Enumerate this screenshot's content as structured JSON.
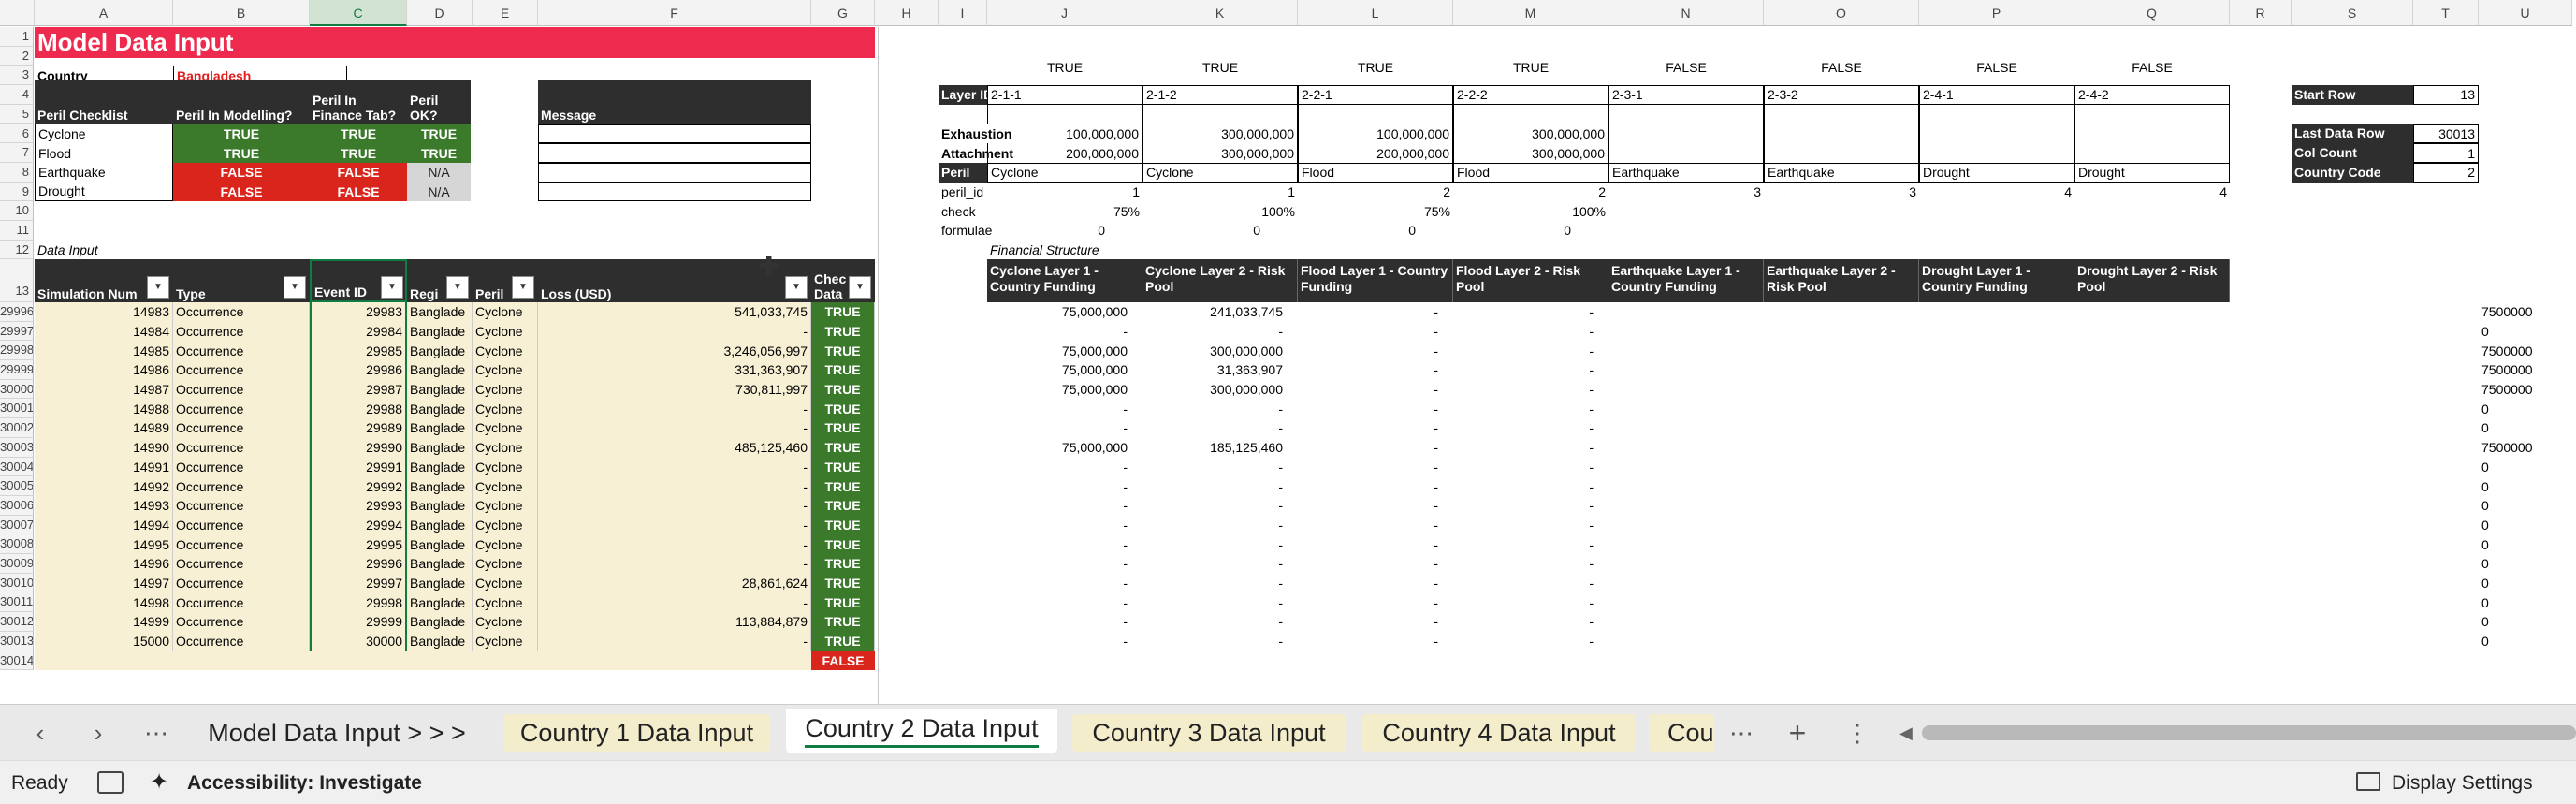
{
  "columns": [
    "A",
    "B",
    "C",
    "D",
    "E",
    "F",
    "G",
    "H",
    "I",
    "J",
    "K",
    "L",
    "M",
    "N",
    "O",
    "P",
    "Q",
    "R",
    "S",
    "T",
    "U"
  ],
  "row_numbers": [
    "1",
    "2",
    "3",
    "4",
    "5",
    "6",
    "7",
    "8",
    "9",
    "10",
    "11",
    "12",
    "13",
    "29996",
    "29997",
    "29998",
    "29999",
    "30000",
    "30001",
    "30002",
    "30003",
    "30004",
    "30005",
    "30006",
    "30007",
    "30008",
    "30009",
    "30010",
    "30011",
    "30012",
    "30013",
    "30014"
  ],
  "title": "Model Data Input",
  "country_label": "Country",
  "country_value": "Bangladesh",
  "peril_checklist": {
    "h1": "Peril Checklist",
    "h2": "Peril In Modelling?",
    "h3": "Peril In Finance Tab?",
    "h4": "Peril OK?",
    "h5": "Message",
    "rows": [
      {
        "name": "Cyclone",
        "m": "TRUE",
        "f": "TRUE",
        "ok": "TRUE"
      },
      {
        "name": "Flood",
        "m": "TRUE",
        "f": "TRUE",
        "ok": "TRUE"
      },
      {
        "name": "Earthquake",
        "m": "FALSE",
        "f": "FALSE",
        "ok": "N/A"
      },
      {
        "name": "Drought",
        "m": "FALSE",
        "f": "FALSE",
        "ok": "N/A"
      }
    ]
  },
  "data_input_label": "Data Input",
  "financial_structure_label": "Financial Structure",
  "table_headers": [
    "Simulation Num",
    "Type",
    "Event ID",
    "Regi",
    "Peril",
    "Loss (USD)",
    "Chec Data"
  ],
  "data_rows": [
    [
      "14983",
      "Occurrence",
      "29983",
      "Banglade",
      "Cyclone",
      "541,033,745",
      "TRUE"
    ],
    [
      "14984",
      "Occurrence",
      "29984",
      "Banglade",
      "Cyclone",
      "-",
      "TRUE"
    ],
    [
      "14985",
      "Occurrence",
      "29985",
      "Banglade",
      "Cyclone",
      "3,246,056,997",
      "TRUE"
    ],
    [
      "14986",
      "Occurrence",
      "29986",
      "Banglade",
      "Cyclone",
      "331,363,907",
      "TRUE"
    ],
    [
      "14987",
      "Occurrence",
      "29987",
      "Banglade",
      "Cyclone",
      "730,811,997",
      "TRUE"
    ],
    [
      "14988",
      "Occurrence",
      "29988",
      "Banglade",
      "Cyclone",
      "-",
      "TRUE"
    ],
    [
      "14989",
      "Occurrence",
      "29989",
      "Banglade",
      "Cyclone",
      "-",
      "TRUE"
    ],
    [
      "14990",
      "Occurrence",
      "29990",
      "Banglade",
      "Cyclone",
      "485,125,460",
      "TRUE"
    ],
    [
      "14991",
      "Occurrence",
      "29991",
      "Banglade",
      "Cyclone",
      "-",
      "TRUE"
    ],
    [
      "14992",
      "Occurrence",
      "29992",
      "Banglade",
      "Cyclone",
      "-",
      "TRUE"
    ],
    [
      "14993",
      "Occurrence",
      "29993",
      "Banglade",
      "Cyclone",
      "-",
      "TRUE"
    ],
    [
      "14994",
      "Occurrence",
      "29994",
      "Banglade",
      "Cyclone",
      "-",
      "TRUE"
    ],
    [
      "14995",
      "Occurrence",
      "29995",
      "Banglade",
      "Cyclone",
      "-",
      "TRUE"
    ],
    [
      "14996",
      "Occurrence",
      "29996",
      "Banglade",
      "Cyclone",
      "-",
      "TRUE"
    ],
    [
      "14997",
      "Occurrence",
      "29997",
      "Banglade",
      "Cyclone",
      "28,861,624",
      "TRUE"
    ],
    [
      "14998",
      "Occurrence",
      "29998",
      "Banglade",
      "Cyclone",
      "-",
      "TRUE"
    ],
    [
      "14999",
      "Occurrence",
      "29999",
      "Banglade",
      "Cyclone",
      "113,884,879",
      "TRUE"
    ],
    [
      "15000",
      "Occurrence",
      "30000",
      "Banglade",
      "Cyclone",
      "-",
      "TRUE"
    ]
  ],
  "last_check": "FALSE",
  "layers": {
    "flags": [
      "TRUE",
      "TRUE",
      "TRUE",
      "TRUE",
      "FALSE",
      "FALSE",
      "FALSE",
      "FALSE"
    ],
    "layer_id_label": "Layer ID",
    "ids": [
      "2-1-1",
      "2-1-2",
      "2-2-1",
      "2-2-2",
      "2-3-1",
      "2-3-2",
      "2-4-1",
      "2-4-2"
    ],
    "exhaustion_label": "Exhaustion",
    "exhaustion": [
      "100,000,000",
      "300,000,000",
      "100,000,000",
      "300,000,000",
      "",
      "",
      "",
      ""
    ],
    "attachment_label": "Attachment",
    "attachment": [
      "200,000,000",
      "300,000,000",
      "200,000,000",
      "300,000,000",
      "",
      "",
      "",
      ""
    ],
    "peril_label": "Peril",
    "perils": [
      "Cyclone",
      "Cyclone",
      "Flood",
      "Flood",
      "Earthquake",
      "Earthquake",
      "Drought",
      "Drought"
    ],
    "peril_id_label": "peril_id",
    "peril_ids": [
      "1",
      "1",
      "2",
      "2",
      "3",
      "3",
      "4",
      "4"
    ],
    "check_label": "check",
    "checks": [
      "75%",
      "100%",
      "75%",
      "100%",
      "",
      "",
      "",
      ""
    ],
    "formulae_label": "formulae",
    "formulae": [
      "0",
      "0",
      "0",
      "0",
      "",
      "",
      "",
      ""
    ],
    "headers": [
      "Cyclone Layer 1 - Country Funding",
      "Cyclone Layer 2 - Risk Pool",
      "Flood Layer 1 - Country Funding",
      "Flood Layer 2 - Risk Pool",
      "Earthquake Layer 1 - Country Funding",
      "Earthquake Layer 2 - Risk Pool",
      "Drought Layer 1 - Country Funding",
      "Drought Layer 2 - Risk Pool"
    ]
  },
  "fin_rows": [
    [
      "75,000,000",
      "241,033,745",
      "-",
      "-"
    ],
    [
      "-",
      "-",
      "-",
      "-"
    ],
    [
      "75,000,000",
      "300,000,000",
      "-",
      "-"
    ],
    [
      "75,000,000",
      "31,363,907",
      "-",
      "-"
    ],
    [
      "75,000,000",
      "300,000,000",
      "-",
      "-"
    ],
    [
      "-",
      "-",
      "-",
      "-"
    ],
    [
      "-",
      "-",
      "-",
      "-"
    ],
    [
      "75,000,000",
      "185,125,460",
      "-",
      "-"
    ],
    [
      "-",
      "-",
      "-",
      "-"
    ],
    [
      "-",
      "-",
      "-",
      "-"
    ],
    [
      "-",
      "-",
      "-",
      "-"
    ],
    [
      "-",
      "-",
      "-",
      "-"
    ],
    [
      "-",
      "-",
      "-",
      "-"
    ],
    [
      "-",
      "-",
      "-",
      "-"
    ],
    [
      "-",
      "-",
      "-",
      "-"
    ],
    [
      "-",
      "-",
      "-",
      "-"
    ],
    [
      "-",
      "-",
      "-",
      "-"
    ],
    [
      "-",
      "-",
      "-",
      "-"
    ]
  ],
  "u_col": [
    "7500000",
    "0",
    "7500000",
    "7500000",
    "7500000",
    "0",
    "0",
    "7500000",
    "0",
    "0",
    "0",
    "0",
    "0",
    "0",
    "0",
    "0",
    "0",
    "0"
  ],
  "side_params": [
    {
      "label": "Start Row",
      "value": "13"
    },
    {
      "label": "Last Data Row",
      "value": "30013"
    },
    {
      "label": "Col Count",
      "value": "1"
    },
    {
      "label": "Country Code",
      "value": "2"
    }
  ],
  "tabs": {
    "menu": "⋯",
    "t0": "Model Data Input > > >",
    "t1": "Country 1 Data Input",
    "t2": "Country 2 Data Input",
    "t3": "Country 3 Data Input",
    "t4": "Country 4 Data Input",
    "t5": "Cou",
    "more": "⋯",
    "add": "+",
    "vmenu": "⋮"
  },
  "status": {
    "ready": "Ready",
    "accessibility": "Accessibility: Investigate",
    "display": "Display Settings"
  }
}
